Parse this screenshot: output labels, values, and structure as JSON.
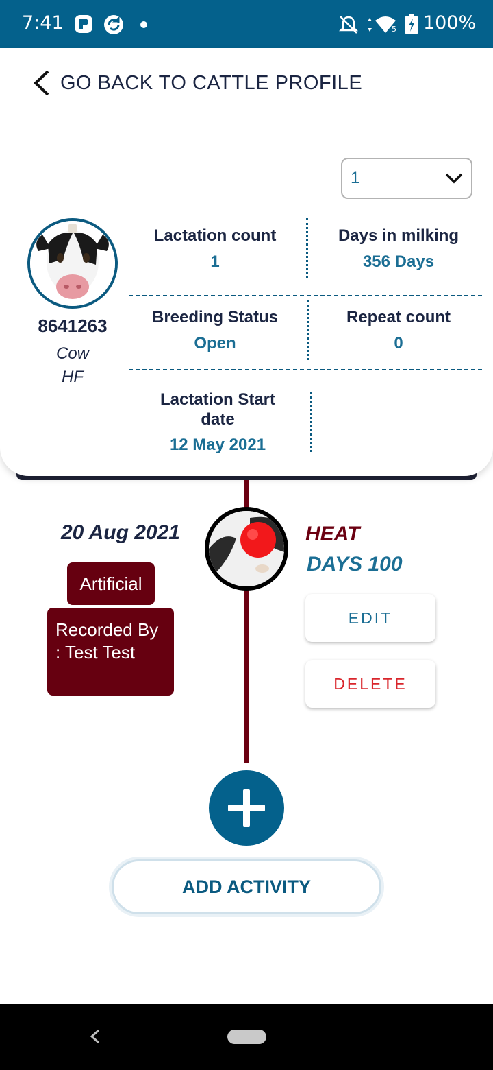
{
  "status_bar": {
    "time": "7:41",
    "battery": "100%",
    "icons": [
      "app-notification-icon",
      "sync-icon",
      "dot-icon",
      "bell-off-icon",
      "wifi-icon",
      "battery-icon"
    ]
  },
  "header": {
    "back_label": "GO BACK TO CATTLE PROFILE"
  },
  "profile": {
    "lactation_select_value": "1",
    "cattle_id": "8641263",
    "type": "Cow",
    "breed": "HF",
    "stats": {
      "lactation_count_label": "Lactation count",
      "lactation_count_value": "1",
      "days_in_milking_label": "Days in milking",
      "days_in_milking_value": "356 Days",
      "breeding_status_label": "Breeding Status",
      "breeding_status_value": "Open",
      "repeat_count_label": "Repeat count",
      "repeat_count_value": "0",
      "lactation_start_label": "Lactation Start date",
      "lactation_start_value": "12 May 2021"
    }
  },
  "timeline": {
    "event": {
      "date": "20 Aug 2021",
      "type": "HEAT",
      "days": "DAYS 100",
      "method_tag": "Artificial",
      "recorded_by": "Recorded By : Test Test",
      "edit_label": "EDIT",
      "delete_label": "DELETE"
    }
  },
  "actions": {
    "add_activity_label": "ADD ACTIVITY"
  },
  "colors": {
    "brand_blue": "#04618c",
    "maroon": "#660010",
    "delete_red": "#d9262c",
    "text_dark": "#1b2542",
    "value_blue": "#1b6e94"
  }
}
